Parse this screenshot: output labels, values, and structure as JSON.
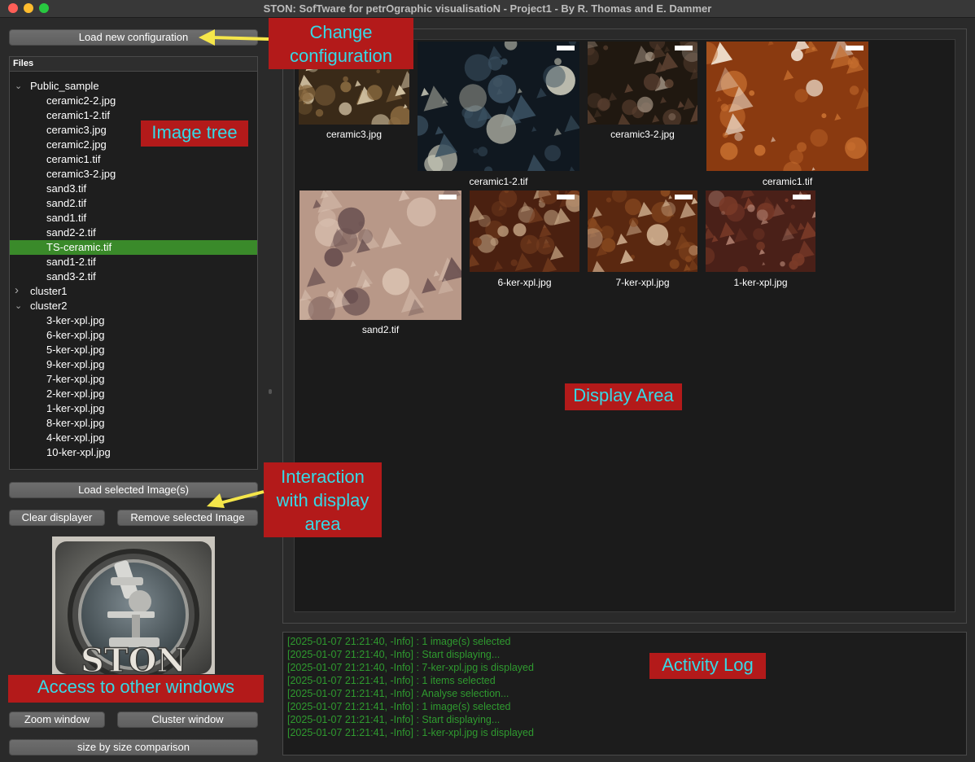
{
  "window": {
    "title": "STON: SofTware for petrOgraphic visualisatioN - Project1 - By R. Thomas and E. Dammer"
  },
  "buttons": {
    "load_config": "Load new configuration",
    "load_selected": "Load selected Image(s)",
    "clear": "Clear displayer",
    "remove": "Remove selected Image",
    "zoom": "Zoom window",
    "cluster": "Cluster window",
    "size_compare": "size by size comparison"
  },
  "tree": {
    "header": "Files",
    "nodes": [
      {
        "label": "Public_sample",
        "type": "folder",
        "expanded": true
      },
      {
        "label": "ceramic2-2.jpg",
        "type": "file"
      },
      {
        "label": "ceramic1-2.tif",
        "type": "file"
      },
      {
        "label": "ceramic3.jpg",
        "type": "file"
      },
      {
        "label": "ceramic2.jpg",
        "type": "file"
      },
      {
        "label": "ceramic1.tif",
        "type": "file"
      },
      {
        "label": "ceramic3-2.jpg",
        "type": "file"
      },
      {
        "label": "sand3.tif",
        "type": "file"
      },
      {
        "label": "sand2.tif",
        "type": "file"
      },
      {
        "label": "sand1.tif",
        "type": "file"
      },
      {
        "label": "sand2-2.tif",
        "type": "file"
      },
      {
        "label": "TS-ceramic.tif",
        "type": "file",
        "selected": true
      },
      {
        "label": "sand1-2.tif",
        "type": "file"
      },
      {
        "label": "sand3-2.tif",
        "type": "file"
      },
      {
        "label": "cluster1",
        "type": "folder",
        "expanded": false
      },
      {
        "label": "cluster2",
        "type": "folder",
        "expanded": true
      },
      {
        "label": "3-ker-xpl.jpg",
        "type": "file"
      },
      {
        "label": "6-ker-xpl.jpg",
        "type": "file"
      },
      {
        "label": "5-ker-xpl.jpg",
        "type": "file"
      },
      {
        "label": "9-ker-xpl.jpg",
        "type": "file"
      },
      {
        "label": "7-ker-xpl.jpg",
        "type": "file"
      },
      {
        "label": "2-ker-xpl.jpg",
        "type": "file"
      },
      {
        "label": "1-ker-xpl.jpg",
        "type": "file"
      },
      {
        "label": "8-ker-xpl.jpg",
        "type": "file"
      },
      {
        "label": "4-ker-xpl.jpg",
        "type": "file"
      },
      {
        "label": "10-ker-xpl.jpg",
        "type": "file"
      }
    ]
  },
  "thumbnails": [
    {
      "label": "ceramic3.jpg",
      "palette": [
        "#3a2a18",
        "#8a6a40",
        "#d8c8a8"
      ]
    },
    {
      "label": "ceramic1-2.tif",
      "palette": [
        "#101820",
        "#3a5060",
        "#c8c8b8"
      ]
    },
    {
      "label": "ceramic3-2.jpg",
      "palette": [
        "#201810",
        "#5a4030",
        "#a09080"
      ]
    },
    {
      "label": "ceramic1.tif",
      "palette": [
        "#8a3a10",
        "#c87030",
        "#f0e0d0"
      ]
    },
    {
      "label": "sand2.tif",
      "palette": [
        "#b89888",
        "#d8c0b0",
        "#6a5050"
      ]
    },
    {
      "label": "6-ker-xpl.jpg",
      "palette": [
        "#4a2010",
        "#7a4020",
        "#c0a080"
      ]
    },
    {
      "label": "7-ker-xpl.jpg",
      "palette": [
        "#5a2810",
        "#8a4a20",
        "#d0b090"
      ]
    },
    {
      "label": "1-ker-xpl.jpg",
      "palette": [
        "#4a2018",
        "#7a3a28",
        "#b08070"
      ]
    }
  ],
  "log": [
    "[2025-01-07 21:21:40, -Info] : 1 image(s) selected",
    "[2025-01-07 21:21:40, -Info] : Start displaying...",
    "[2025-01-07 21:21:40, -Info] : 7-ker-xpl.jpg is displayed",
    "[2025-01-07 21:21:41, -Info] : 1 items selected",
    "[2025-01-07 21:21:41, -Info] : Analyse selection...",
    "[2025-01-07 21:21:41, -Info] : 1 image(s) selected",
    "[2025-01-07 21:21:41, -Info] : Start displaying...",
    "[2025-01-07 21:21:41, -Info] : 1-ker-xpl.jpg is displayed"
  ],
  "annotations": {
    "change_config": "Change\nconfiguration",
    "image_tree": "Image tree",
    "interaction": "Interaction\nwith display\narea",
    "display_area": "Display Area",
    "activity_log": "Activity Log",
    "other_windows": "Access to other windows"
  },
  "logo": {
    "text": "STON"
  },
  "colors": {
    "selection": "#3a8a2a",
    "log_text": "#2f9a2f",
    "annotation_bg": "#b31a1a",
    "annotation_text": "#36d9e6",
    "arrow": "#f5e64a"
  }
}
